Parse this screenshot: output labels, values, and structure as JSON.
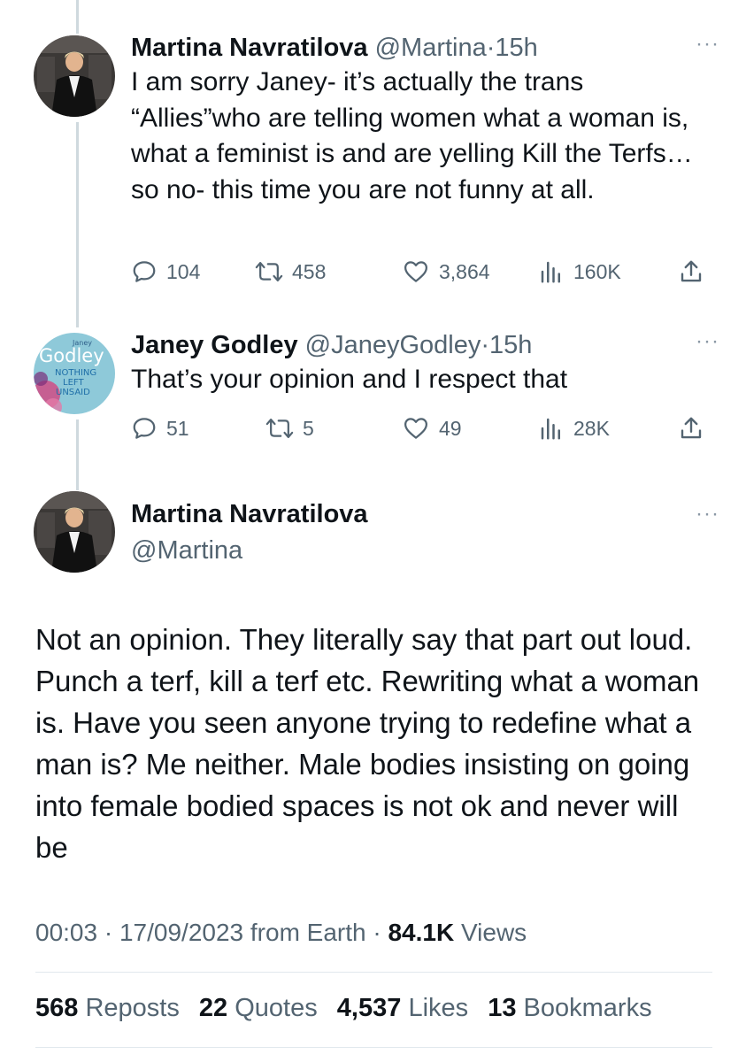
{
  "colors": {
    "text": "#0f1419",
    "secondary": "#536471",
    "thread_line": "#cfd9de",
    "divider": "#e1e8ed"
  },
  "replies": [
    {
      "name": "Martina Navratilova",
      "handle": "@Martina",
      "separator": "·",
      "time": "15h",
      "more": "···",
      "text": "I am sorry Janey- it’s actually the trans “Allies”who are telling women what a woman is, what a feminist is and are yelling Kill the Terfs… so no- this time you are not funny at all.",
      "stats": {
        "replies": "104",
        "reposts": "458",
        "likes": "3,864",
        "views": "160K"
      }
    },
    {
      "name": "Janey Godley",
      "handle": "@JaneyGodley",
      "separator": "·",
      "time": "15h",
      "more": "···",
      "text": "That’s your opinion and I respect that",
      "stats": {
        "replies": "51",
        "reposts": "5",
        "likes": "49",
        "views": "28K"
      },
      "avatar_text": {
        "small": "Janey",
        "title": "Godley",
        "line1": "NOTHING",
        "line2": "LEFT",
        "line3": "UNSAID"
      }
    }
  ],
  "main_tweet": {
    "name": "Martina Navratilova",
    "handle": "@Martina",
    "more": "···",
    "text": "Not an opinion. They literally say that part out loud. Punch a terf, kill a terf etc. Rewriting what a woman is. Have you seen anyone trying to redefine what a man is? Me neither. Male bodies insisting on going into female bodied spaces is not ok and never will be",
    "time": "00:03",
    "separator": "·",
    "date": "17/09/2023",
    "source": "from Earth",
    "views": "84.1K",
    "views_label": "Views",
    "reposts": "568",
    "reposts_label": "Reposts",
    "quotes": "22",
    "quotes_label": "Quotes",
    "likes": "4,537",
    "likes_label": "Likes",
    "bookmarks": "13",
    "bookmarks_label": "Bookmarks"
  }
}
